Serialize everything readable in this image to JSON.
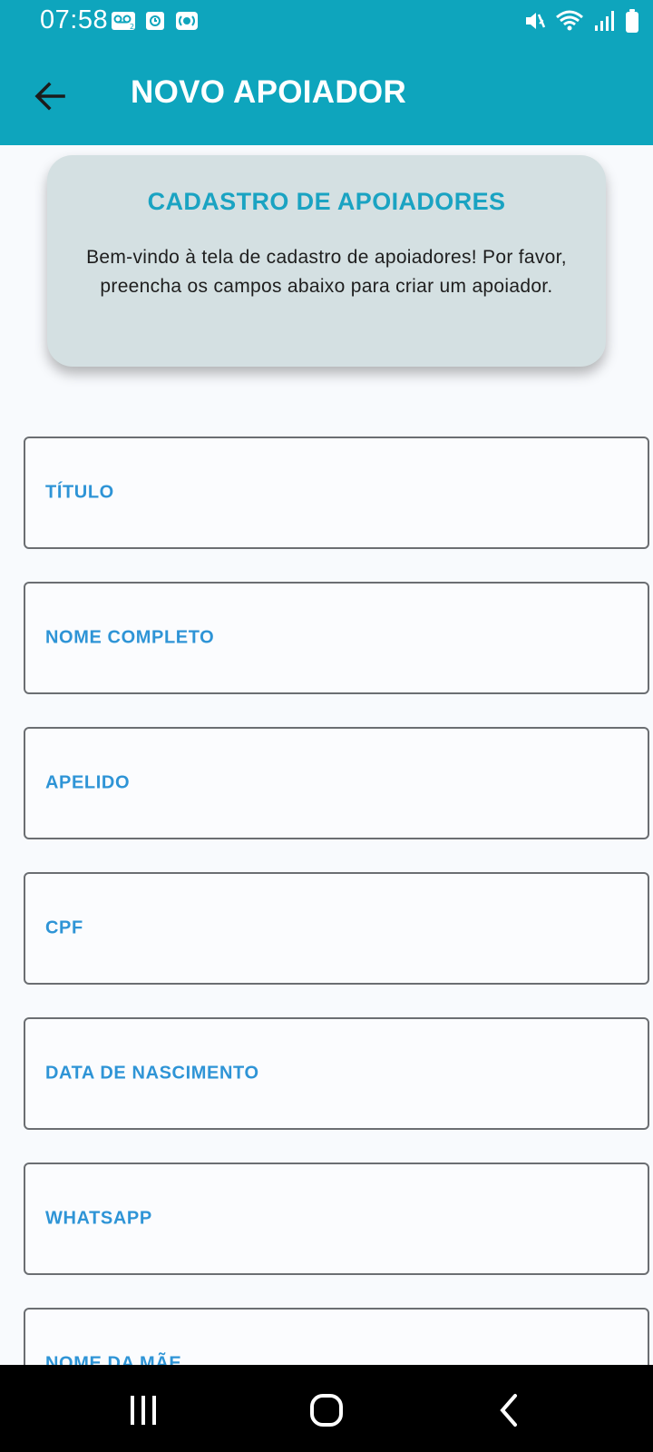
{
  "status_bar": {
    "time": "07:58",
    "left_icons": [
      "voicemail-icon",
      "clock-app-icon",
      "radio-icon"
    ],
    "right_icons": [
      "mute-vibrate-icon",
      "wifi-icon",
      "signal-icon",
      "battery-icon"
    ]
  },
  "appbar": {
    "title": "NOVO APOIADOR",
    "back_icon": "arrow-left-icon"
  },
  "welcome_card": {
    "title": "CADASTRO DE APOIADORES",
    "body": "Bem-vindo à tela de cadastro de apoiadores! Por favor, preencha os campos abaixo para criar um apoiador."
  },
  "form": {
    "fields": [
      {
        "label": "TÍTULO",
        "value": ""
      },
      {
        "label": "NOME COMPLETO",
        "value": ""
      },
      {
        "label": "APELIDO",
        "value": ""
      },
      {
        "label": "CPF",
        "value": ""
      },
      {
        "label": "DATA DE NASCIMENTO",
        "value": ""
      },
      {
        "label": "WHATSAPP",
        "value": ""
      },
      {
        "label": "NOME DA MÃE",
        "value": ""
      }
    ]
  },
  "navbar": {
    "icons": [
      "recent-apps-icon",
      "home-icon",
      "back-icon"
    ]
  },
  "colors": {
    "primary": "#0ea5bd",
    "card_background": "#d4e0e2",
    "card_title": "#1aa3c2",
    "field_label": "#2e94d6"
  }
}
